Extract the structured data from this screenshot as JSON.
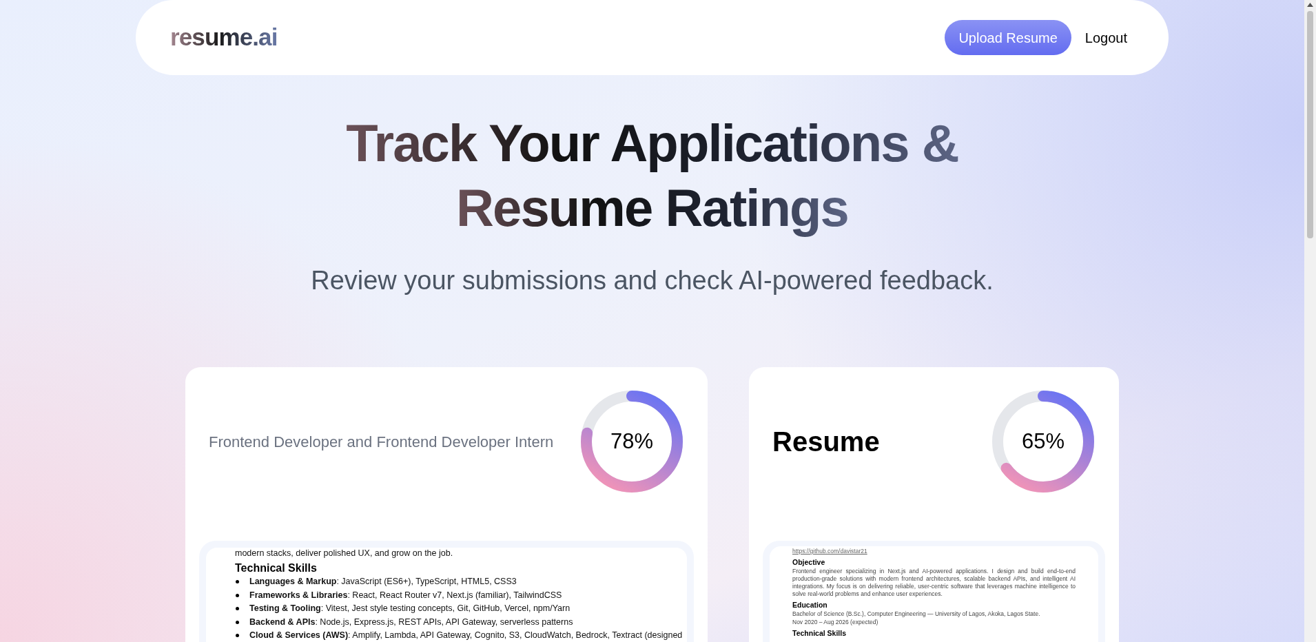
{
  "header": {
    "logo": "resume.ai",
    "upload_button": "Upload Resume",
    "logout": "Logout"
  },
  "hero": {
    "title_lines": [
      "Track Your Applications &",
      "Resume Ratings"
    ],
    "subtitle": "Review your submissions and check AI-powered feedback."
  },
  "cards": [
    {
      "title": "Frontend Developer and Frontend Developer Intern",
      "kind": "job",
      "score": "78%",
      "level": 0.78,
      "preview": {
        "blocks": [
          {
            "kind": "paragraph",
            "text": "modern stacks, deliver polished UX, and grow on the job."
          },
          {
            "kind": "heading",
            "text": "Technical Skills"
          },
          {
            "kind": "bullet",
            "text": "**Languages & Markup**: JavaScript (ES6+), TypeScript, HTML5, CSS3"
          },
          {
            "kind": "bullet",
            "text": "**Frameworks & Libraries**: React, React Router v7, Next.js (familiar), TailwindCSS"
          },
          {
            "kind": "bullet",
            "text": "**Testing & Tooling**: Vitest, Jest style testing concepts, Git, GitHub, Vercel, npm/Yarn"
          },
          {
            "kind": "bullet",
            "text": "**Backend & APIs**: Node.js, Express.js, REST APIs, API Gateway, serverless patterns"
          },
          {
            "kind": "bullet",
            "text": "**Cloud & Services (AWS)**: Amplify, Lambda, API Gateway, Cognito, S3, CloudWatch, Bedrock, Textract (designed"
          }
        ]
      }
    },
    {
      "title": "Resume",
      "kind": "plain",
      "score": "65%",
      "level": 0.65,
      "preview": {
        "blocks": [
          {
            "kind": "link",
            "text": "https://github.com/davistar21"
          },
          {
            "kind": "heading",
            "text": "Objective"
          },
          {
            "kind": "paragraph",
            "text": "Frontend engineer specializing in Next.js and AI-powered applications. I design and build end-to-end production-grade solutions with modern frontend architectures, scalable backend APIs, and intelligent AI integrations. My focus is on delivering reliable, user-centric software that leverages machine intelligence to solve real-world problems and enhance user experiences."
          },
          {
            "kind": "heading",
            "text": "Education"
          },
          {
            "kind": "paragraph",
            "text": "Bachelor of Science (B.Sc.), Computer Engineering — University of Lagos, Akoka, Lagos State."
          },
          {
            "kind": "paragraph",
            "text": "Nov 2020 – Aug 2026 (expected)"
          },
          {
            "kind": "heading",
            "text": "Technical Skills"
          }
        ]
      }
    }
  ]
}
